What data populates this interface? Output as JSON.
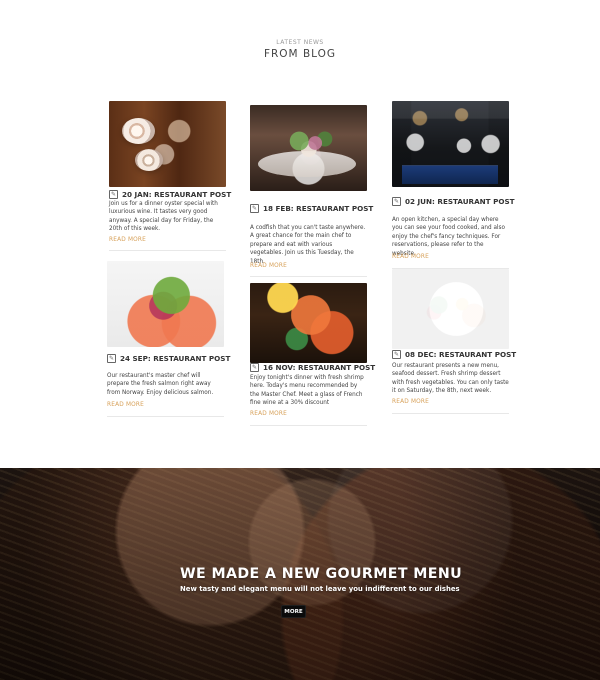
{
  "blog": {
    "kicker": "LATEST NEWS",
    "title": "FROM BLOG",
    "posts": [
      {
        "meta": "20 JAN: RESTAURANT POST",
        "excerpt": "Join us for a dinner oyster special with luxurious wine. It tastes very good anyway. A special day for Friday, the 20th of this week.",
        "read_more": "READ MORE",
        "image_label": "oysters-on-wood-board"
      },
      {
        "meta": "18 FEB: RESTAURANT POST",
        "excerpt": "A codfish that you can't taste anywhere. A great chance for the main chef to prepare and eat with various vegetables. Join us this Tuesday, the 18th.",
        "read_more": "READ MORE",
        "image_label": "plated-codfish"
      },
      {
        "meta": "02 JUN: RESTAURANT POST",
        "excerpt": "An open kitchen, a special day where you can see your food cooked, and also enjoy the chef's fancy techniques. For reservations, please refer to the website.",
        "read_more": "READ MORE",
        "image_label": "open-kitchen-chefs"
      },
      {
        "meta": "24 SEP: RESTAURANT POST",
        "excerpt": "Our restaurant's master chef will prepare the fresh salmon right away from Norway. Enjoy delicious salmon.",
        "read_more": "READ MORE",
        "image_label": "salmon-salad"
      },
      {
        "meta": "16 NOV: RESTAURANT POST",
        "excerpt": "Enjoy tonight's dinner with fresh shrimp here. Today's menu recommended by the Master Chef. Meet a glass of French fine wine at a 30% discount",
        "read_more": "READ MORE",
        "image_label": "shrimp-dish"
      },
      {
        "meta": "08 DEC: RESTAURANT POST",
        "excerpt": "Our restaurant presents a new menu, seafood dessert. Fresh shrimp dessert with fresh vegetables. You can only taste it on Saturday, the 8th, next week.",
        "read_more": "READ MORE",
        "image_label": "plated-dessert"
      }
    ]
  },
  "hero": {
    "title": "WE MADE A NEW GOURMET MENU",
    "subtitle": "New tasty and elegant menu will not leave you indifferent to our dishes",
    "button": "MORE"
  },
  "icons": {
    "post_meta": "edit-icon"
  }
}
